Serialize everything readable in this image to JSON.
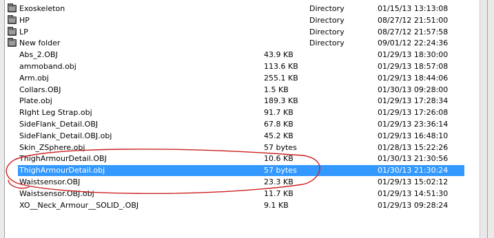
{
  "colors": {
    "selection": "#3399ff",
    "annotation": "#cc1f1f"
  },
  "files": [
    {
      "name": "Exoskeleton",
      "size": "",
      "type": "Directory",
      "date": "01/15/13 13:13:08",
      "icon": "folder-icon"
    },
    {
      "name": "HP",
      "size": "",
      "type": "Directory",
      "date": "08/27/12 21:51:00",
      "icon": "folder-icon"
    },
    {
      "name": "LP",
      "size": "",
      "type": "Directory",
      "date": "08/27/12 21:57:58",
      "icon": "folder-icon"
    },
    {
      "name": "New folder",
      "size": "",
      "type": "Directory",
      "date": "09/01/12 22:24:36",
      "icon": "folder-icon"
    },
    {
      "name": "Abs_2.OBJ",
      "size": "43.9 KB",
      "type": "",
      "date": "01/29/13 18:30:00"
    },
    {
      "name": "ammoband.obj",
      "size": "113.6 KB",
      "type": "",
      "date": "01/29/13 18:57:08"
    },
    {
      "name": "Arm.obj",
      "size": "255.1 KB",
      "type": "",
      "date": "01/29/13 18:44:06"
    },
    {
      "name": "Collars.OBJ",
      "size": "1.5 KB",
      "type": "",
      "date": "01/30/13 09:28:00"
    },
    {
      "name": "Plate.obj",
      "size": "189.3 KB",
      "type": "",
      "date": "01/29/13 17:28:34"
    },
    {
      "name": "RIght Leg Strap.obj",
      "size": "91.7 KB",
      "type": "",
      "date": "01/29/13 17:26:08"
    },
    {
      "name": "SideFlank_Detail.OBJ",
      "size": "67.8 KB",
      "type": "",
      "date": "01/29/13 23:36:14"
    },
    {
      "name": "SideFlank_Detail.OBJ.obj",
      "size": "45.2 KB",
      "type": "",
      "date": "01/29/13 16:48:10"
    },
    {
      "name": "Skin_ZSphere.obj",
      "size": "57 bytes",
      "type": "",
      "date": "01/28/13 15:22:26"
    },
    {
      "name": "ThighArmourDetail.OBJ",
      "size": "10.6 KB",
      "type": "",
      "date": "01/30/13 21:30:56"
    },
    {
      "name": "ThighArmourDetail.obj",
      "size": "57 bytes",
      "type": "",
      "date": "01/30/13 21:30:24",
      "selected": true
    },
    {
      "name": "Waistsensor.OBJ",
      "size": "23.3 KB",
      "type": "",
      "date": "01/29/13 15:02:12"
    },
    {
      "name": "Waistsensor.OBJ.obj",
      "size": "11.7 KB",
      "type": "",
      "date": "01/29/13 14:51:30"
    },
    {
      "name": "XO__Neck_Armour__SOLID_.OBJ",
      "size": "9.1 KB",
      "type": "",
      "date": "01/29/13 09:28:24"
    }
  ]
}
